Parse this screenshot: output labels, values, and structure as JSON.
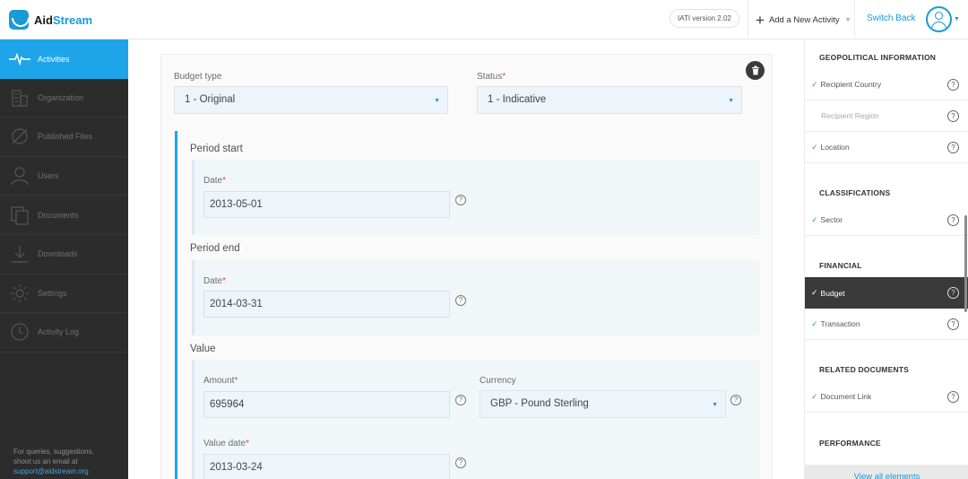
{
  "header": {
    "logo_part1": "Aid",
    "logo_part2": "Stream",
    "version": "IATI version 2.02",
    "add_activity": "Add a New Activity",
    "switch_back": "Switch Back"
  },
  "sidebar": {
    "items": [
      {
        "label": "Activities",
        "icon": "activity-pulse-icon"
      },
      {
        "label": "Organization",
        "icon": "building-icon"
      },
      {
        "label": "Published Files",
        "icon": "compass-icon"
      },
      {
        "label": "Users",
        "icon": "user-icon"
      },
      {
        "label": "Documents",
        "icon": "documents-icon"
      },
      {
        "label": "Downloads",
        "icon": "download-icon"
      },
      {
        "label": "Settings",
        "icon": "gear-icon"
      },
      {
        "label": "Activity Log",
        "icon": "clock-icon"
      }
    ],
    "footer_line1": "For queries, suggestions,",
    "footer_line2": "shoot us an email at",
    "footer_email": "support@aidstream.org"
  },
  "form": {
    "budget_type_label": "Budget type",
    "budget_type_value": "1 - Original",
    "status_label": "Status",
    "status_value": "1 - Indicative",
    "period_start_title": "Period start",
    "period_start_date_label": "Date",
    "period_start_date": "2013-05-01",
    "period_end_title": "Period end",
    "period_end_date_label": "Date",
    "period_end_date": "2014-03-31",
    "value_title": "Value",
    "amount_label": "Amount",
    "amount_value": "695964",
    "currency_label": "Currency",
    "currency_value": "GBP - Pound Sterling",
    "value_date_label": "Value date",
    "value_date": "2013-03-24",
    "required_mark": "*",
    "help_glyph": "?"
  },
  "right_panel": {
    "geo_head": "GEOPOLITICAL INFORMATION",
    "recipient_country": "Recipient Country",
    "recipient_region": "Recipient Region",
    "location": "Location",
    "class_head": "CLASSIFICATIONS",
    "sector": "Sector",
    "fin_head": "FINANCIAL",
    "budget": "Budget",
    "transaction": "Transaction",
    "docs_head": "RELATED DOCUMENTS",
    "document_link": "Document Link",
    "perf_head": "PERFORMANCE",
    "view_all": "View all elements"
  }
}
